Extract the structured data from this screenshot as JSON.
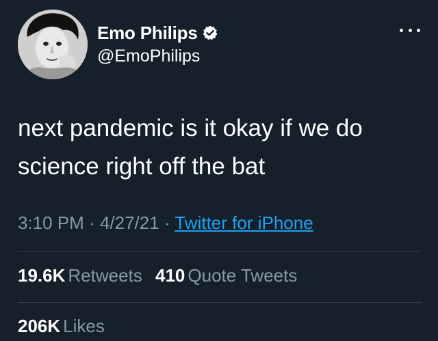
{
  "author": {
    "display_name": "Emo Philips",
    "handle": "@EmoPhilips",
    "verified": true,
    "avatar_icon": "profile-photo"
  },
  "tweet": {
    "text": "next pandemic is it okay if we do science right off the bat"
  },
  "meta": {
    "time": "3:10 PM",
    "separator": "·",
    "date": "4/27/21",
    "source": "Twitter for iPhone"
  },
  "stats": {
    "retweets_count": "19.6K",
    "retweets_label": "Retweets",
    "quotes_count": "410",
    "quotes_label": "Quote Tweets",
    "likes_count": "206K",
    "likes_label": "Likes"
  },
  "colors": {
    "background": "#15202b",
    "text": "#ffffff",
    "muted": "#8899a6",
    "link": "#1da1f2",
    "divider": "#38444d"
  }
}
